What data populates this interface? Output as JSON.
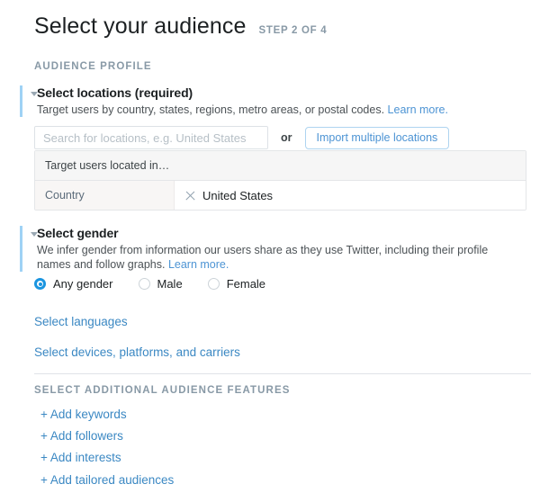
{
  "header": {
    "title": "Select your audience",
    "step": "STEP 2 OF 4"
  },
  "audience_profile": {
    "caption": "AUDIENCE PROFILE",
    "locations": {
      "title": "Select locations (required)",
      "description": "Target users by country, states, regions, metro areas, or postal codes.",
      "learn_more": "Learn more.",
      "chevron_icon": "chevron-down-icon",
      "search": {
        "placeholder": "Search for locations, e.g. United States",
        "value": ""
      },
      "or_label": "or",
      "import_button": "Import multiple locations",
      "table": {
        "header": "Target users located in…",
        "rows": [
          {
            "label": "Country",
            "value": "United States",
            "remove_icon": "close-x-icon"
          }
        ]
      }
    },
    "gender": {
      "title": "Select gender",
      "description": "We infer gender from information our users share as they use Twitter, including their profile names and follow graphs.",
      "learn_more": "Learn more.",
      "chevron_icon": "chevron-down-icon",
      "options": [
        {
          "label": "Any gender",
          "selected": true
        },
        {
          "label": "Male",
          "selected": false
        },
        {
          "label": "Female",
          "selected": false
        }
      ]
    },
    "links": [
      {
        "label": "Select languages"
      },
      {
        "label": "Select devices, platforms, and carriers"
      }
    ]
  },
  "additional_features": {
    "caption": "SELECT ADDITIONAL AUDIENCE FEATURES",
    "items": [
      {
        "label": "+ Add keywords"
      },
      {
        "label": "+ Add followers"
      },
      {
        "label": "+ Add interests"
      },
      {
        "label": "+ Add tailored audiences"
      }
    ]
  },
  "colors": {
    "accent_blue": "#1b95e0",
    "link_blue": "#3b88c3",
    "muted_blue": "#4d94d4",
    "caption_gray": "#8899a6",
    "accent_bar": "#9fd2f5"
  }
}
